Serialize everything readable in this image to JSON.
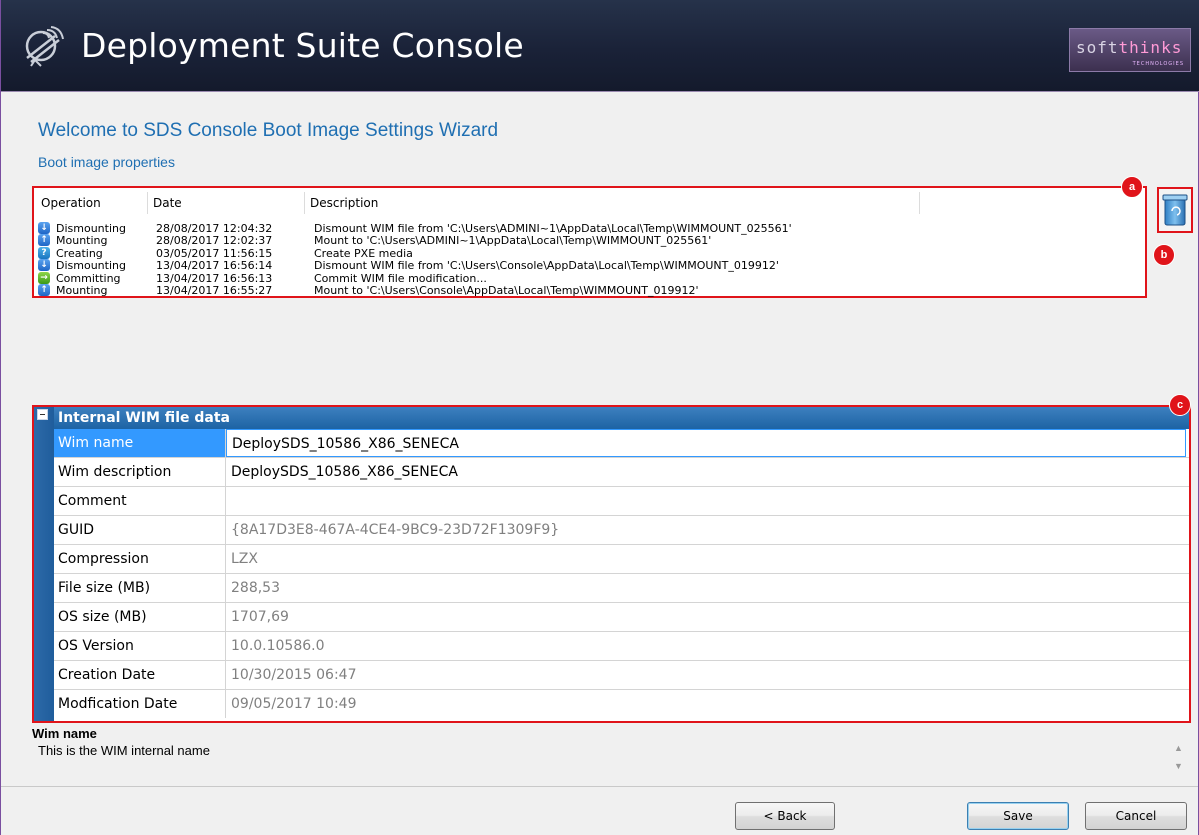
{
  "app": {
    "title": "Deployment Suite Console",
    "brand": {
      "text_a": "soft",
      "text_b": "thinks",
      "sub": "TECHNOLOGIES"
    }
  },
  "wizard": {
    "title": "Welcome to SDS Console Boot Image Settings Wizard",
    "subtitle": "Boot image properties"
  },
  "markers": {
    "a": "a",
    "b": "b",
    "c": "c"
  },
  "log": {
    "columns": [
      "Operation",
      "Date",
      "Description"
    ],
    "rows": [
      {
        "icon": "arrow-down-icon",
        "operation": "Dismounting",
        "date": "28/08/2017 12:04:32",
        "description": "Dismount WIM file from 'C:\\Users\\ADMINI~1\\AppData\\Local\\Temp\\WIMMOUNT_025561'"
      },
      {
        "icon": "arrow-up-icon",
        "operation": "Mounting",
        "date": "28/08/2017 12:02:37",
        "description": "Mount to 'C:\\Users\\ADMINI~1\\AppData\\Local\\Temp\\WIMMOUNT_025561'"
      },
      {
        "icon": "help-icon",
        "operation": "Creating",
        "date": "03/05/2017 11:56:15",
        "description": "Create PXE media"
      },
      {
        "icon": "arrow-down-icon",
        "operation": "Dismounting",
        "date": "13/04/2017 16:56:14",
        "description": "Dismount WIM file from 'C:\\Users\\Console\\AppData\\Local\\Temp\\WIMMOUNT_019912'"
      },
      {
        "icon": "commit-arrow-icon",
        "operation": "Committing",
        "date": "13/04/2017 16:56:13",
        "description": "Commit WIM file modification..."
      },
      {
        "icon": "arrow-up-icon",
        "operation": "Mounting",
        "date": "13/04/2017 16:55:27",
        "description": "Mount to 'C:\\Users\\Console\\AppData\\Local\\Temp\\WIMMOUNT_019912'"
      }
    ]
  },
  "grid": {
    "category": "Internal WIM file data",
    "rows": [
      {
        "name": "Wim name",
        "value": "DeploySDS_10586_X86_SENECA",
        "readonly": false
      },
      {
        "name": "Wim description",
        "value": "DeploySDS_10586_X86_SENECA",
        "readonly": false
      },
      {
        "name": "Comment",
        "value": "",
        "readonly": false
      },
      {
        "name": "GUID",
        "value": "{8A17D3E8-467A-4CE4-9BC9-23D72F1309F9}",
        "readonly": true
      },
      {
        "name": "Compression",
        "value": "LZX",
        "readonly": true
      },
      {
        "name": "File size (MB)",
        "value": "288,53",
        "readonly": true
      },
      {
        "name": "OS size (MB)",
        "value": "1707,69",
        "readonly": true
      },
      {
        "name": "OS Version",
        "value": "10.0.10586.0",
        "readonly": true
      },
      {
        "name": "Creation Date",
        "value": "10/30/2015  06:47",
        "readonly": true
      },
      {
        "name": "Modfication Date",
        "value": "09/05/2017  10:49",
        "readonly": true
      }
    ]
  },
  "help": {
    "title": "Wim name",
    "text": "This is the WIM internal name"
  },
  "buttons": {
    "back": "< Back",
    "save": "Save",
    "cancel": "Cancel"
  },
  "colors": {
    "accent": "#1f6fb2",
    "highlight": "#e0141a",
    "grid_header": "#1d63a4",
    "selection": "#3399ff"
  }
}
